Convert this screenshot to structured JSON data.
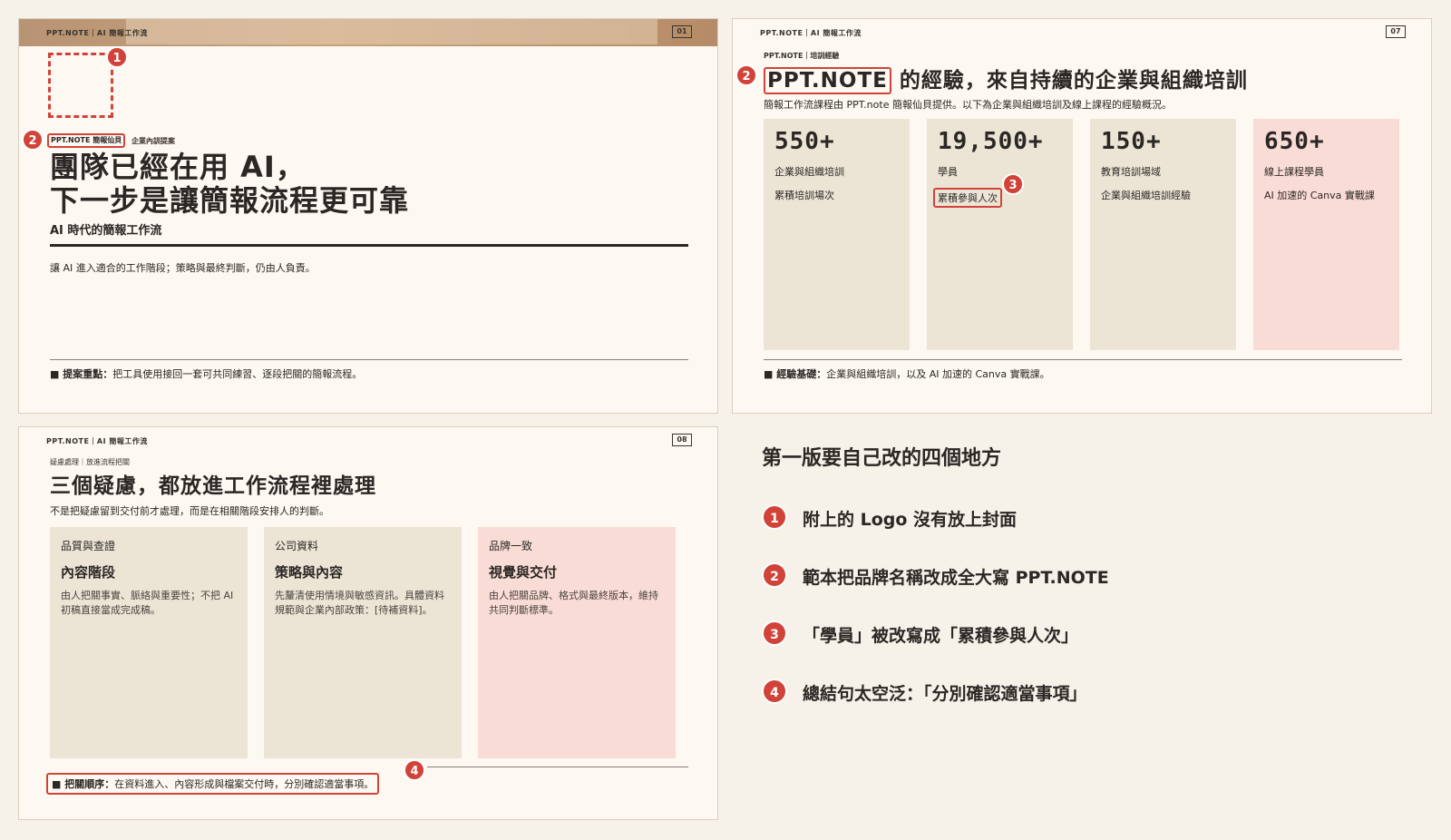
{
  "slide1": {
    "brand": "PPT.NOTE｜AI 簡報工作流",
    "page": "01",
    "badge1": "1",
    "badge2": "2",
    "kicker_brand": "PPT.NOTE 簡報仙貝",
    "kicker_note": "企業內訓提案",
    "title_line1": "團隊已經在用 AI，",
    "title_line2": "下一步是讓簡報流程更可靠",
    "subtitle": "AI 時代的簡報工作流",
    "body": "讓 AI 進入適合的工作階段；策略與最終判斷，仍由人負責。",
    "footer_label": "■ 提案重點：",
    "footer_text": "把工具使用接回一套可共同練習、逐段把關的簡報流程。"
  },
  "slide2": {
    "brand": "PPT.NOTE｜AI 簡報工作流",
    "page": "07",
    "kicker": "PPT.NOTE｜培訓經驗",
    "badge2": "2",
    "badge3": "3",
    "title_hl": "PPT.NOTE",
    "title_rest": " 的經驗，來自持續的企業與組織培訓",
    "desc": "簡報工作流課程由 PPT.note 簡報仙貝提供。以下為企業與組織培訓及線上課程的經驗概況。",
    "stats": [
      {
        "num": "550+",
        "l1": "企業與組織培訓",
        "l2": "累積培訓場次"
      },
      {
        "num": "19,500+",
        "l1": "學員",
        "l2": "累積參與人次"
      },
      {
        "num": "150+",
        "l1": "教育培訓場域",
        "l2": "企業與組織培訓經驗"
      },
      {
        "num": "650+",
        "l1": "線上課程學員",
        "l2": "AI 加速的 Canva 實戰課"
      }
    ],
    "footer_label": "■ 經驗基礎：",
    "footer_text": "企業與組織培訓，以及 AI 加速的 Canva 實戰課。"
  },
  "slide3": {
    "brand": "PPT.NOTE｜AI 簡報工作流",
    "page": "08",
    "kicker": "疑慮處理｜放進流程把關",
    "title": "三個疑慮，都放進工作流程裡處理",
    "desc": "不是把疑慮留到交付前才處理，而是在相關階段安排人的判斷。",
    "badge4": "4",
    "cards": [
      {
        "cat": "品質與查證",
        "head": "內容階段",
        "text": "由人把關事實、脈絡與重要性；不把 AI 初稿直接當成完成稿。"
      },
      {
        "cat": "公司資料",
        "head": "策略與內容",
        "text": "先釐清使用情境與敏感資訊。具體資料規範與企業內部政策：[待補資料]。"
      },
      {
        "cat": "品牌一致",
        "head": "視覺與交付",
        "text": "由人把關品牌、格式與最終版本，維持共同判斷標準。"
      }
    ],
    "footer_label": "■ 把關順序：",
    "footer_text": "在資料進入、內容形成與檔案交付時，分別確認適當事項。"
  },
  "notes": {
    "title": "第一版要自己改的四個地方",
    "items": [
      {
        "n": "1",
        "text": "附上的 Logo 沒有放上封面"
      },
      {
        "n": "2",
        "text": "範本把品牌名稱改成全大寫 PPT.NOTE"
      },
      {
        "n": "3",
        "text": "「學員」被改寫成「累積參與人次」"
      },
      {
        "n": "4",
        "text": "總結句太空泛：「分別確認適當事項」"
      }
    ]
  },
  "colors": {
    "accent": "#d14338",
    "card": "#ece5d6",
    "card_pink": "#fadcd6",
    "slide_bg": "#fdf8f2"
  }
}
